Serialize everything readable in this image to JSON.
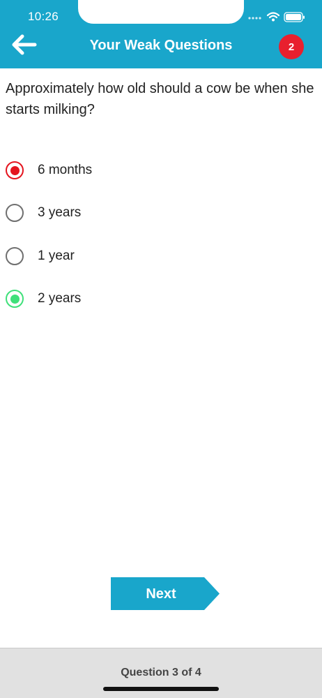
{
  "status_bar": {
    "time": "10:26",
    "icons": [
      "signal-dots-icon",
      "wifi-icon",
      "battery-icon"
    ]
  },
  "header": {
    "title": "Your Weak Questions",
    "badge_count": "2",
    "back_icon": "arrow-left-icon"
  },
  "question": {
    "text": "Approximately how old should a cow be when she starts milking?"
  },
  "options": [
    {
      "label": "6 months",
      "state": "selected-wrong"
    },
    {
      "label": "3 years",
      "state": "unselected"
    },
    {
      "label": "1 year",
      "state": "unselected"
    },
    {
      "label": "2 years",
      "state": "correct"
    }
  ],
  "next_button": {
    "label": "Next"
  },
  "footer": {
    "progress_text": "Question 3 of 4"
  },
  "colors": {
    "header": "#19a6cb",
    "badge": "#e8202e",
    "wrong": "#e4141e",
    "correct": "#3fe07a",
    "footer": "#e1e1e1"
  }
}
